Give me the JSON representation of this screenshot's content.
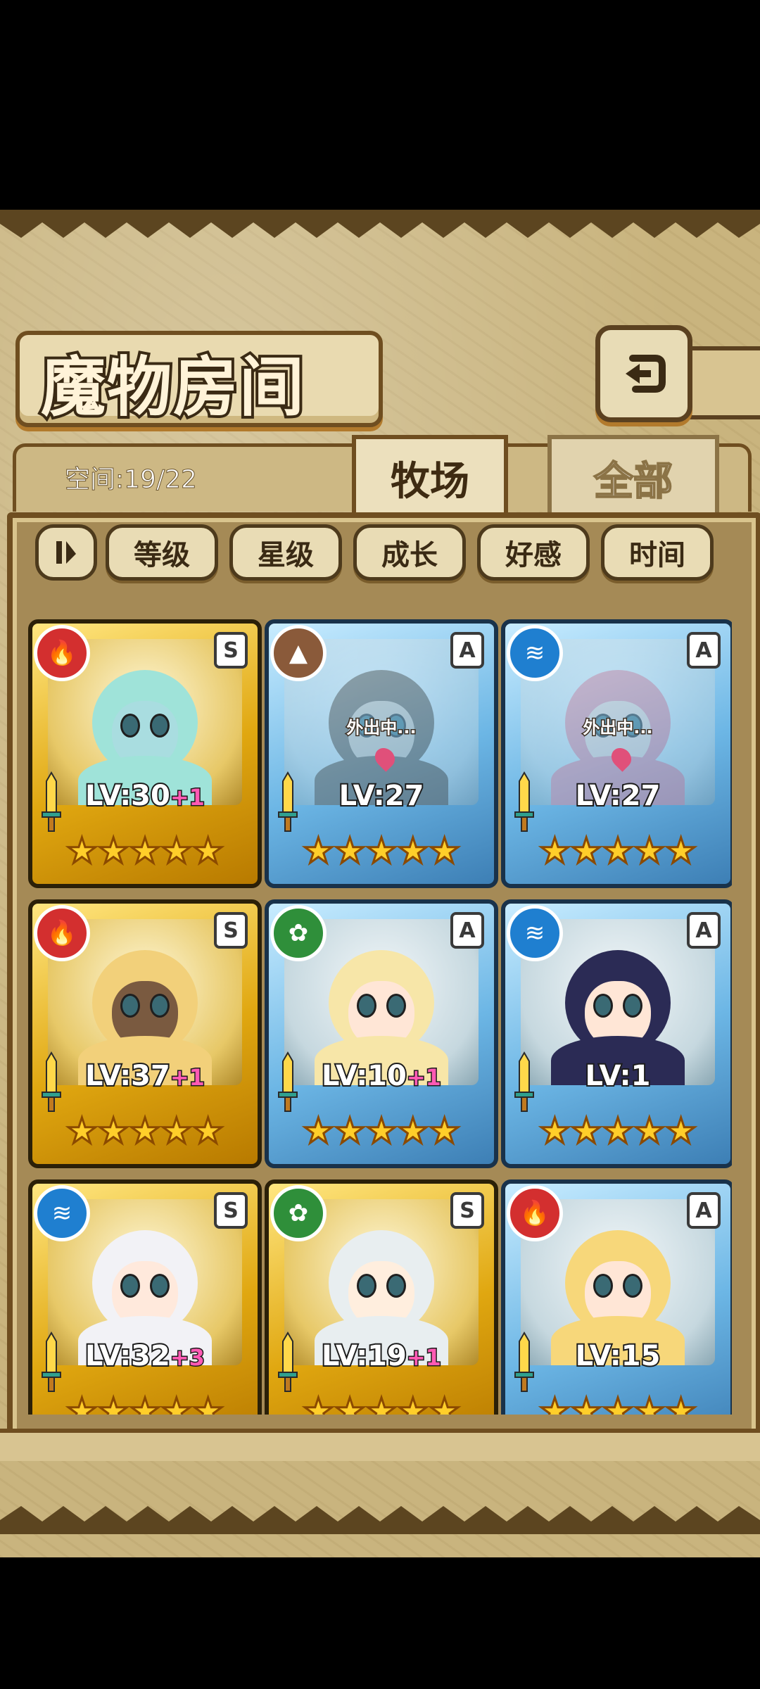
{
  "title": "魔物房间",
  "space": "空间:19/22",
  "tabs": {
    "active": "牧场",
    "inactive": "全部"
  },
  "filters": [
    "等级",
    "星级",
    "成长",
    "好感",
    "时间"
  ],
  "icons": {
    "back": "return-arrow-icon",
    "toggle": "sort-order-icon"
  },
  "away_text": "外出中...",
  "cards": [
    {
      "frame": "gold",
      "element": "fire",
      "rank": "S",
      "lv": "LV:30",
      "plus": "+1",
      "stars": "★★★★★",
      "away": false
    },
    {
      "frame": "blue",
      "element": "earth",
      "rank": "A",
      "lv": "LV:27",
      "plus": "",
      "stars": "★★★★★",
      "away": true
    },
    {
      "frame": "blue",
      "element": "water",
      "rank": "A",
      "lv": "LV:27",
      "plus": "",
      "stars": "★★★★★",
      "away": true
    },
    {
      "frame": "gold",
      "element": "fire",
      "rank": "S",
      "lv": "LV:37",
      "plus": "+1",
      "stars": "★★★★★",
      "away": false
    },
    {
      "frame": "blue",
      "element": "wind",
      "rank": "A",
      "lv": "LV:10",
      "plus": "+1",
      "stars": "★★★★★",
      "away": false
    },
    {
      "frame": "blue",
      "element": "water",
      "rank": "A",
      "lv": "LV:1",
      "plus": "",
      "stars": "★★★★★",
      "away": false
    },
    {
      "frame": "gold",
      "element": "water",
      "rank": "S",
      "lv": "LV:32",
      "plus": "+3",
      "stars": "★★★★★",
      "away": false
    },
    {
      "frame": "gold",
      "element": "wind",
      "rank": "S",
      "lv": "LV:19",
      "plus": "+1",
      "stars": "★★★★★",
      "away": false
    },
    {
      "frame": "blue",
      "element": "fire",
      "rank": "A",
      "lv": "LV:15",
      "plus": "",
      "stars": "★★★★★",
      "away": false
    }
  ],
  "element_colors": {
    "fire": "#d32f2f",
    "earth": "#8a5a3a",
    "water": "#1f7fd0",
    "wind": "#2f8f3a"
  },
  "element_glyphs": {
    "fire": "🔥",
    "earth": "▲",
    "water": "≋",
    "wind": "✿"
  }
}
